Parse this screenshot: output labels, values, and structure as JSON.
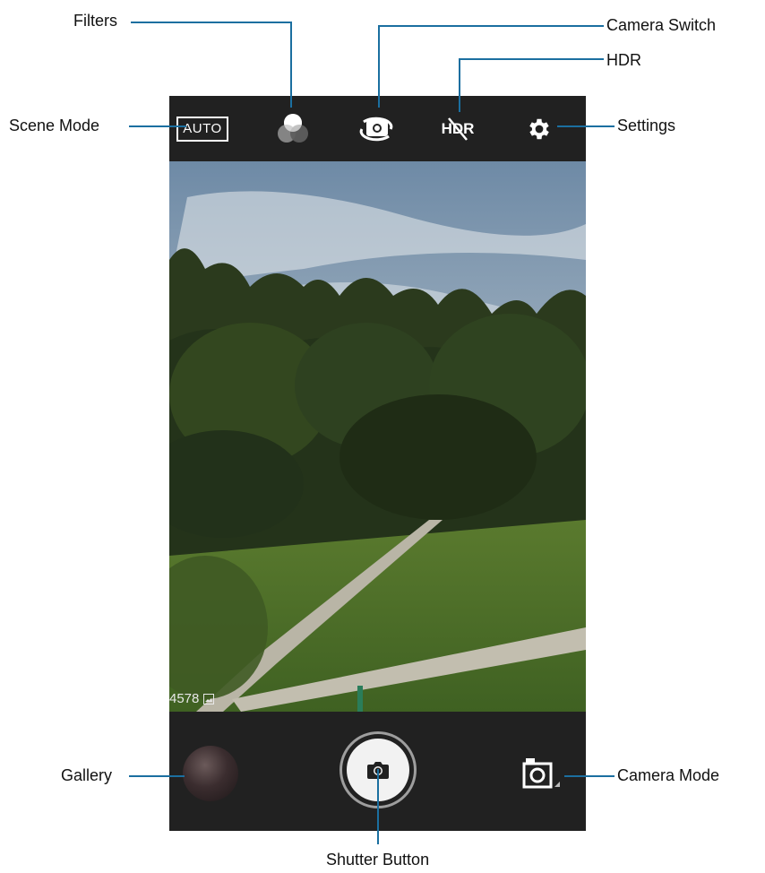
{
  "callouts": {
    "filters": "Filters",
    "camera_switch": "Camera Switch",
    "hdr": "HDR",
    "scene_mode": "Scene Mode",
    "settings": "Settings",
    "gallery": "Gallery",
    "camera_mode": "Camera Mode",
    "shutter_button": "Shutter Button"
  },
  "topbar": {
    "scene_mode_label": "AUTO",
    "hdr_label": "HDR",
    "icons": [
      "filters-icon",
      "camera-switch-icon",
      "hdr-off-icon",
      "settings-gear-icon"
    ]
  },
  "viewfinder": {
    "remaining_shots": "4578"
  },
  "bottombar": {
    "icons": [
      "gallery-thumbnail",
      "shutter-camera-icon",
      "camera-mode-icon"
    ]
  },
  "colors": {
    "leader_line": "#1b6fa0",
    "bar_background": "#212121"
  }
}
